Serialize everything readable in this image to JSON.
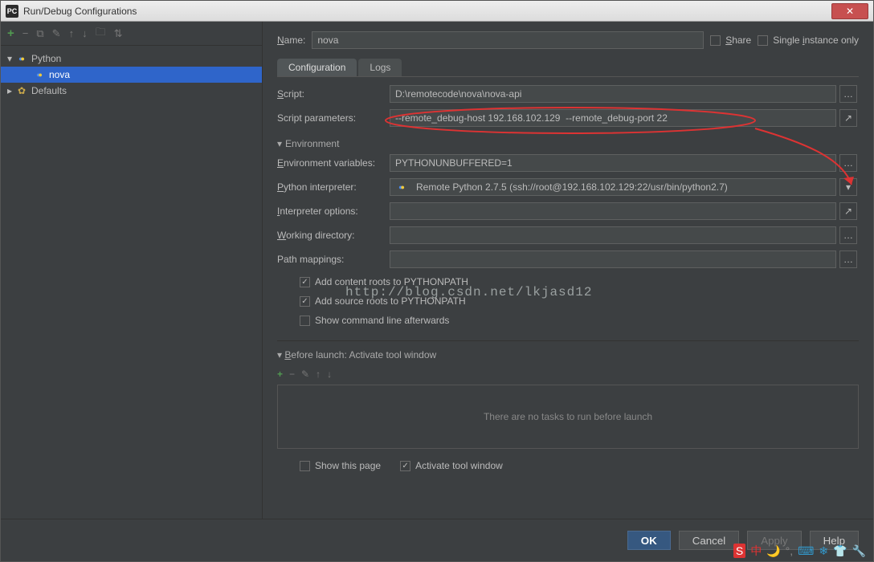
{
  "window": {
    "title": "Run/Debug Configurations"
  },
  "sidebar": {
    "nodes": [
      {
        "label": "Python",
        "kind": "python-group"
      },
      {
        "label": "nova",
        "kind": "python-config",
        "selected": true
      },
      {
        "label": "Defaults",
        "kind": "defaults"
      }
    ]
  },
  "header": {
    "name_label": "Name:",
    "name_value": "nova",
    "share_label": "Share",
    "single_instance_label": "Single instance only"
  },
  "tabs": {
    "config": "Configuration",
    "logs": "Logs",
    "active": "config"
  },
  "form": {
    "script_label": "Script:",
    "script_value": "D:\\remotecode\\nova\\nova-api",
    "params_label": "Script parameters:",
    "params_value": "--remote_debug-host 192.168.102.129  --remote_debug-port 22",
    "env_section": "Environment",
    "envvars_label": "Environment variables:",
    "envvars_value": "PYTHONUNBUFFERED=1",
    "interp_label": "Python interpreter:",
    "interp_value": "Remote Python 2.7.5 (ssh://root@192.168.102.129:22/usr/bin/python2.7)",
    "interp_opts_label": "Interpreter options:",
    "interp_opts_value": "",
    "wd_label": "Working directory:",
    "wd_value": "",
    "pm_label": "Path mappings:",
    "pm_value": "",
    "add_content_roots": "Add content roots to PYTHONPATH",
    "add_source_roots": "Add source roots to PYTHONPATH",
    "show_cmd": "Show command line afterwards"
  },
  "before_launch": {
    "title": "Before launch: Activate tool window",
    "empty_text": "There are no tasks to run before launch",
    "show_this_page": "Show this page",
    "activate_tool": "Activate tool window"
  },
  "buttons": {
    "ok": "OK",
    "cancel": "Cancel",
    "apply": "Apply",
    "help": "Help"
  },
  "watermark": "http://blog.csdn.net/lkjasd12"
}
